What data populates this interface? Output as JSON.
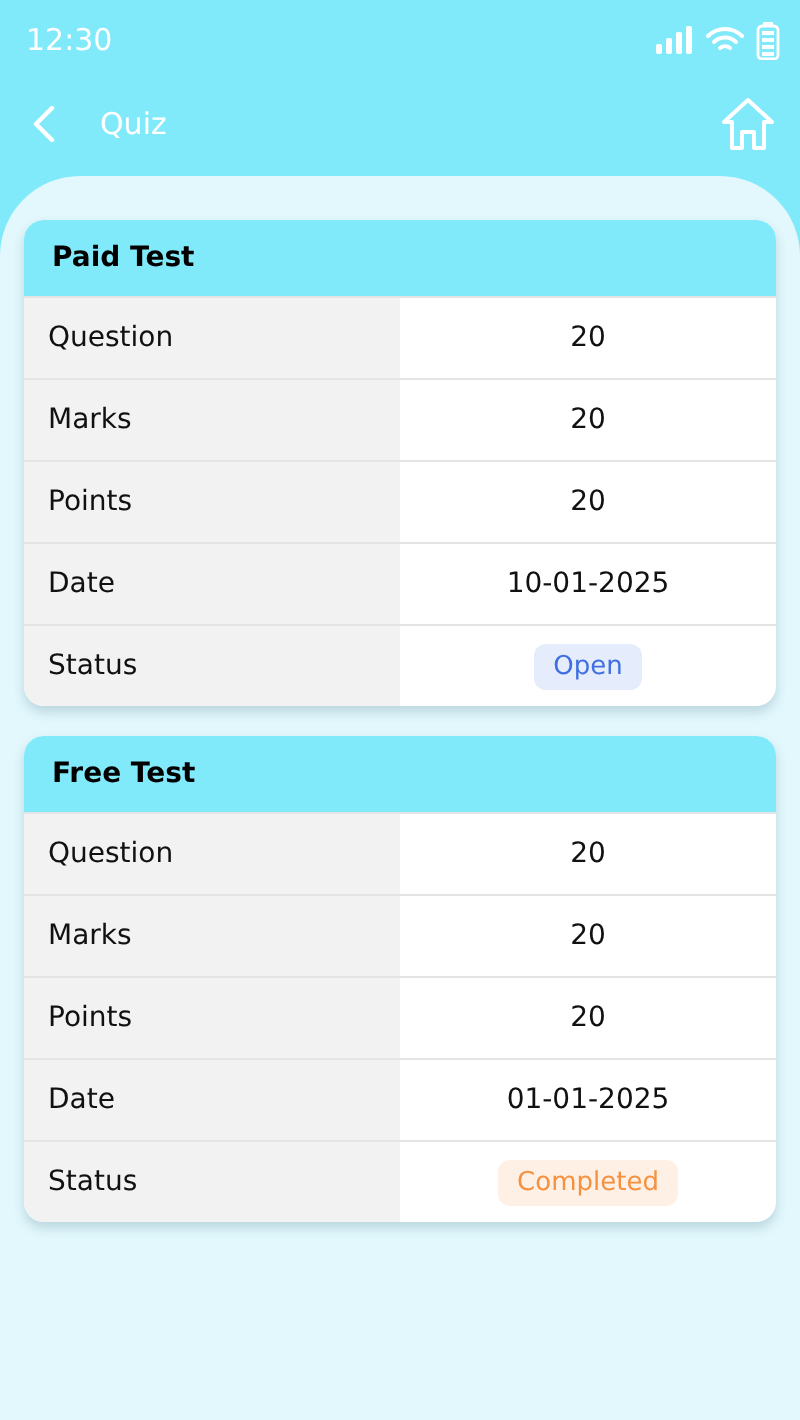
{
  "status_bar": {
    "time": "12:30"
  },
  "header": {
    "title": "Quiz"
  },
  "cards": [
    {
      "title": "Paid Test",
      "rows": [
        {
          "kind": "text",
          "label": "Question",
          "value": "20"
        },
        {
          "kind": "text",
          "label": "Marks",
          "value": "20"
        },
        {
          "kind": "text",
          "label": "Points",
          "value": "20"
        },
        {
          "kind": "text",
          "label": "Date",
          "value": "10-01-2025"
        },
        {
          "kind": "badge",
          "label": "Status",
          "value": "Open",
          "color": "#3f6fe0"
        }
      ]
    },
    {
      "title": "Free Test",
      "rows": [
        {
          "kind": "text",
          "label": "Question",
          "value": "20"
        },
        {
          "kind": "text",
          "label": "Marks",
          "value": "20"
        },
        {
          "kind": "text",
          "label": "Points",
          "value": "20"
        },
        {
          "kind": "text",
          "label": "Date",
          "value": "01-01-2025"
        },
        {
          "kind": "badge",
          "label": "Status",
          "value": "Completed",
          "color": "#f5913f"
        }
      ]
    }
  ]
}
